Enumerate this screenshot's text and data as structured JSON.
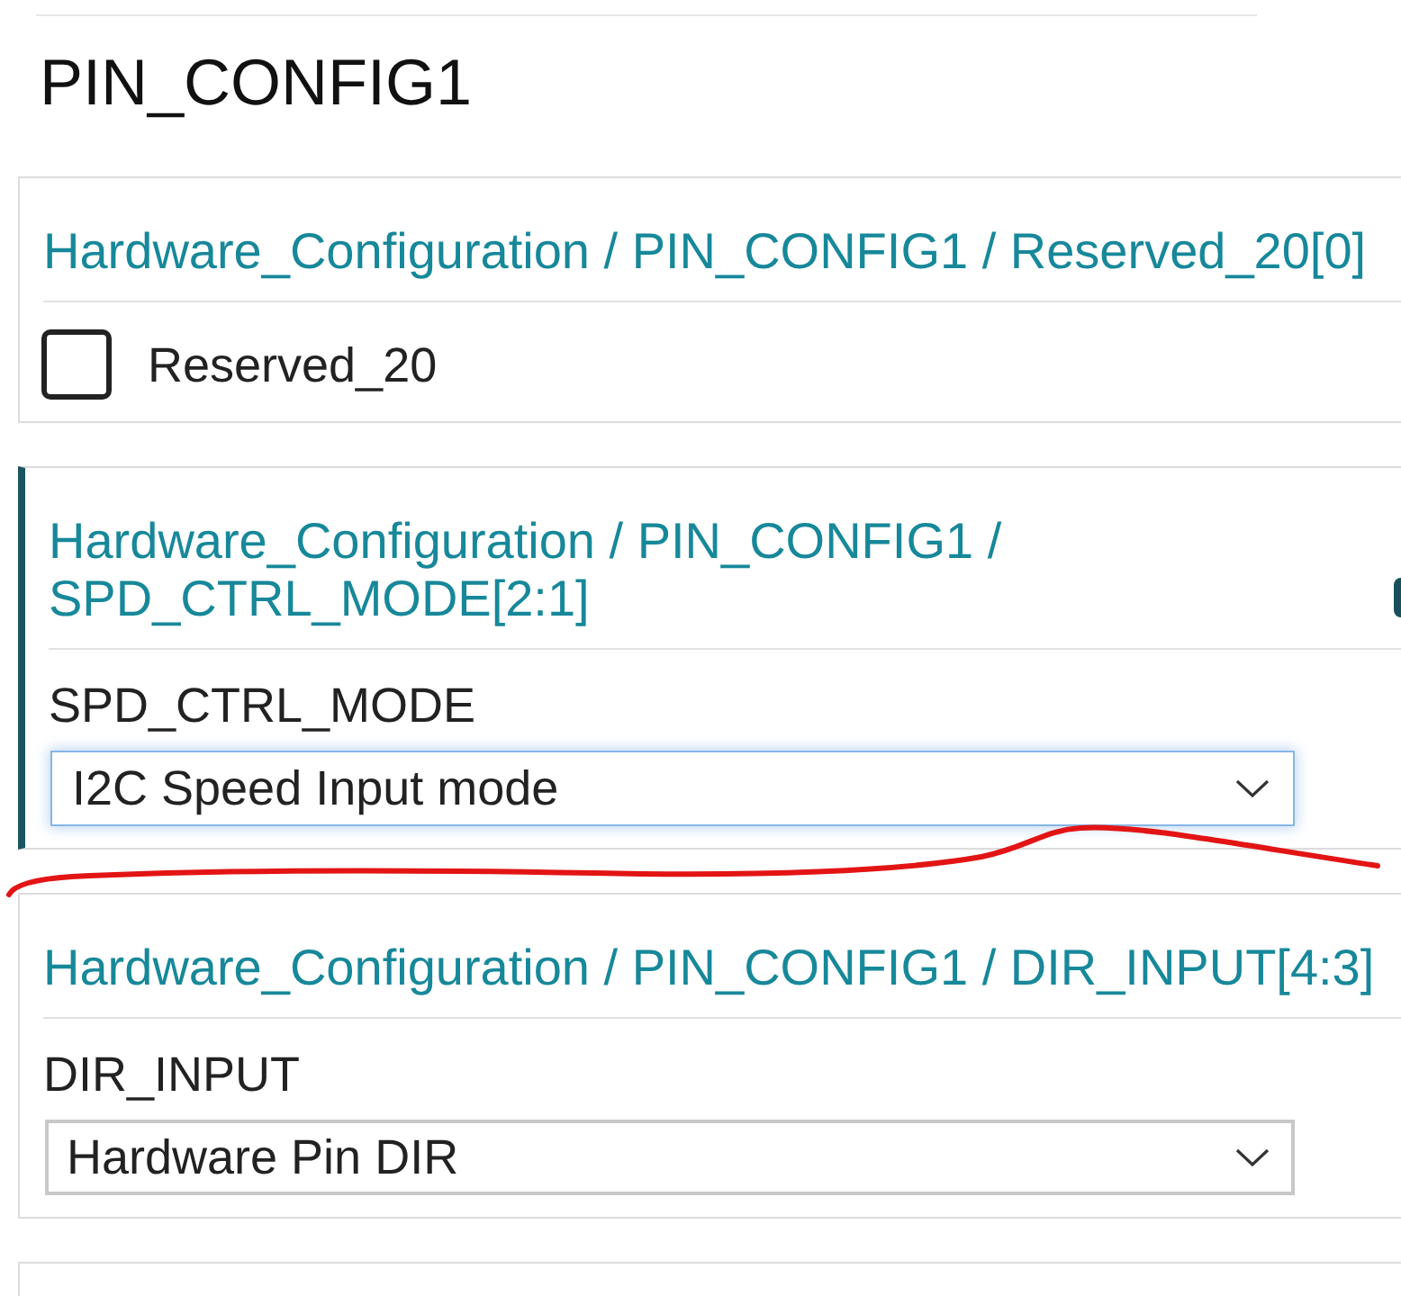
{
  "section_title": "PIN_CONFIG1",
  "fields": [
    {
      "kind": "checkbox",
      "path": "Hardware_Configuration / PIN_CONFIG1 / Reserved_20[0]",
      "active": false,
      "label": "Reserved_20",
      "checked": false
    },
    {
      "kind": "dropdown",
      "path": "Hardware_Configuration / PIN_CONFIG1 / SPD_CTRL_MODE[2:1]",
      "active": true,
      "label": "SPD_CTRL_MODE",
      "value": "I2C Speed Input mode",
      "focused": true
    },
    {
      "kind": "dropdown",
      "path": "Hardware_Configuration / PIN_CONFIG1 / DIR_INPUT[4:3]",
      "active": false,
      "label": "DIR_INPUT",
      "value": "Hardware Pin DIR",
      "focused": false
    },
    {
      "kind": "offscreen"
    }
  ],
  "annotation": {
    "kind": "freehand-line"
  }
}
